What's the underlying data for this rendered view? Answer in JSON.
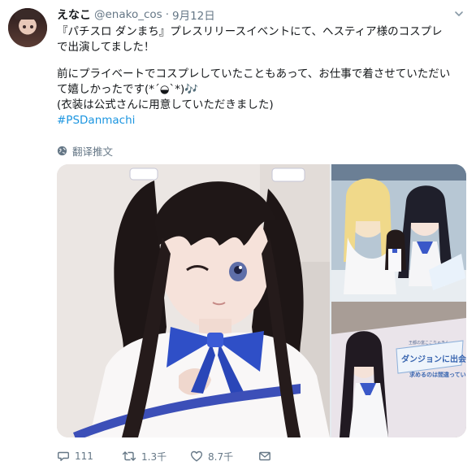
{
  "user": {
    "name": "えなこ",
    "handle": "@enako_cos",
    "separator": "·",
    "date": "9月12日"
  },
  "tweet": {
    "lines": [
      "『パチスロ ダンまち』プレスリリースイベントにて、ヘスティア様のコスプレ",
      "で出演してました！",
      "",
      "前にプライベートでコスプレしていたこともあって、お仕事で着させていただい",
      "て嬉しかったです(*´◒`*)🎶",
      "(衣装は公式さんに用意していただきました)"
    ],
    "hashtag": "#PSDanmachi"
  },
  "translate": {
    "label": "翻译推文",
    "icon": "globe-icon"
  },
  "media": {
    "photos": [
      {
        "description": "cosplay-selfie"
      },
      {
        "description": "poster-with-cosplayer"
      },
      {
        "description": "danmachi-poster"
      }
    ],
    "poster_text": {
      "title": "ダンジョンに出会いを",
      "subtitle": "求めるのは間違っているだろうか"
    }
  },
  "actions": {
    "reply_count": "111",
    "retweet_count": "1.3千",
    "like_count": "8.7千"
  },
  "colors": {
    "link": "#1b95e0",
    "muted": "#657786",
    "text": "#14171a"
  }
}
